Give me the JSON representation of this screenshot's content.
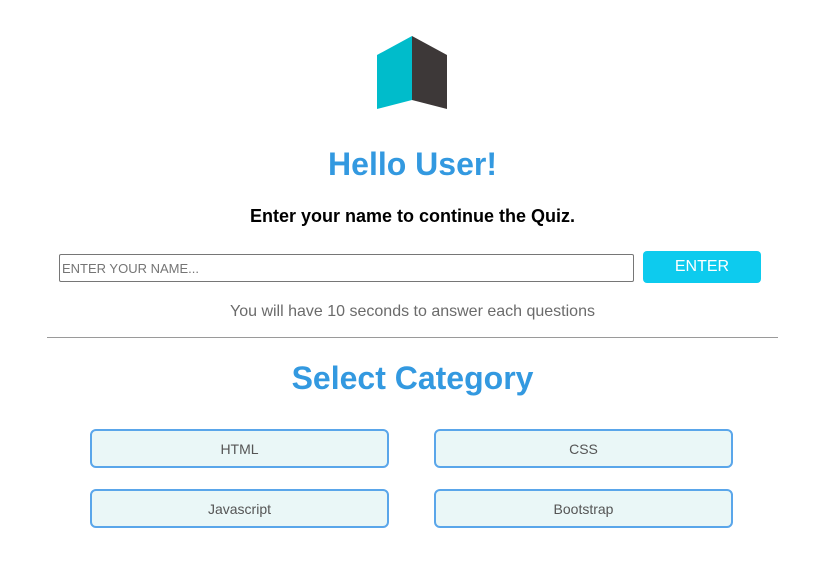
{
  "logo": {
    "icon": "cube-logo-icon",
    "colors": {
      "left_face": "#00bccb",
      "right_face": "#3d3838"
    }
  },
  "header": {
    "greeting": "Hello User!",
    "instruction": "Enter your name to continue the Quiz."
  },
  "name_form": {
    "input_value": "",
    "placeholder": "ENTER YOUR NAME...",
    "enter_label": "ENTER"
  },
  "timer_note": "You will have 10 seconds to answer each questions",
  "categories": {
    "heading": "Select Category",
    "items": [
      {
        "label": "HTML"
      },
      {
        "label": "CSS"
      },
      {
        "label": "Javascript"
      },
      {
        "label": "Bootstrap"
      }
    ]
  },
  "colors": {
    "accent_blue": "#3399e0",
    "button_cyan": "#0dcbee",
    "category_border": "#5aa6ea",
    "category_background": "#eaf7f7"
  }
}
